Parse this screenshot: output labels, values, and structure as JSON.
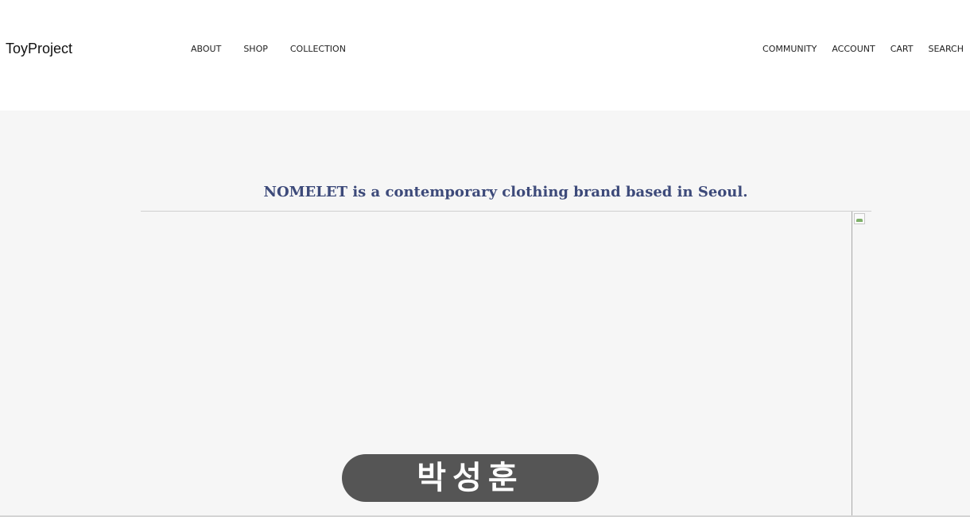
{
  "header": {
    "logo": "ToyProject",
    "nav_left": [
      "ABOUT",
      "SHOP",
      "COLLECTION"
    ],
    "nav_right": [
      "COMMUNITY",
      "ACCOUNT",
      "CART",
      "SEARCH"
    ]
  },
  "hero": {
    "tagline": "NOMELET is a contemporary clothing brand based in Seoul.",
    "name_button_label": "박성훈"
  },
  "icons": {
    "broken_image": "broken-image-icon"
  }
}
